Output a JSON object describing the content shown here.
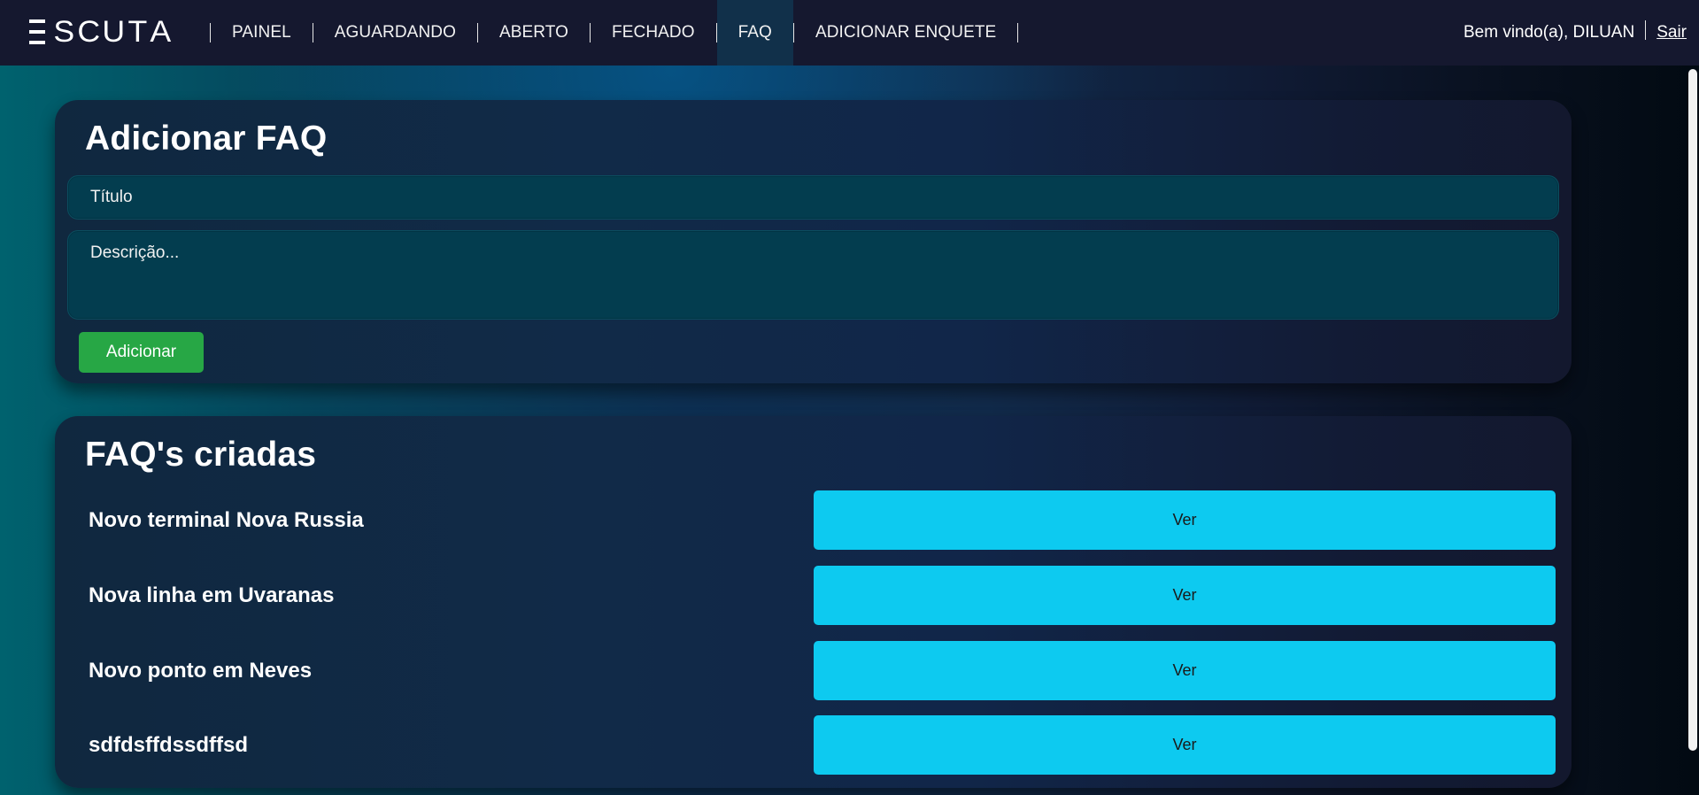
{
  "brand": {
    "letters": [
      "S",
      "C",
      "U",
      "T",
      "A"
    ]
  },
  "nav": {
    "items": [
      {
        "label": "PAINEL",
        "active": false
      },
      {
        "label": "AGUARDANDO",
        "active": false
      },
      {
        "label": "ABERTO",
        "active": false
      },
      {
        "label": "FECHADO",
        "active": false
      },
      {
        "label": "FAQ",
        "active": true
      },
      {
        "label": "ADICIONAR ENQUETE",
        "active": false
      }
    ],
    "welcome": "Bem vindo(a), DILUAN",
    "logout": "Sair"
  },
  "add_faq": {
    "title": "Adicionar FAQ",
    "title_placeholder": "Título",
    "description_placeholder": "Descrição...",
    "submit_label": "Adicionar"
  },
  "faq_list": {
    "title": "FAQ's criadas",
    "items": [
      {
        "title": "Novo terminal Nova Russia",
        "action": "Ver"
      },
      {
        "title": "Nova linha em Uvaranas",
        "action": "Ver"
      },
      {
        "title": "Novo ponto em Neves",
        "action": "Ver"
      },
      {
        "title": "sdfdsffdssdffsd",
        "action": "Ver"
      }
    ]
  },
  "colors": {
    "navbar_bg": "#15182f",
    "add_button": "#27a745",
    "view_button": "#0dcaf0"
  }
}
